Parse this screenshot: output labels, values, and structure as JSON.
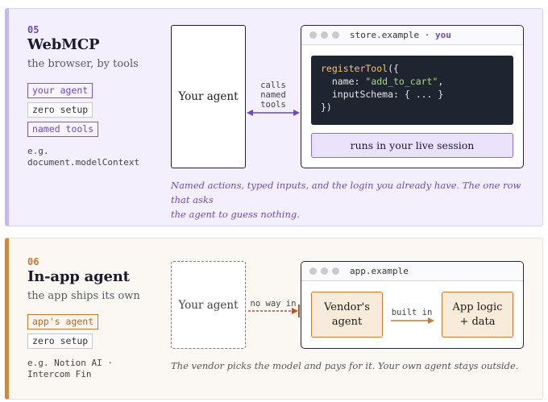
{
  "colors": {
    "purple_accent": "#6d4cb8",
    "orange_accent": "#c47a35",
    "code_bg": "#1e2430"
  },
  "sections": [
    {
      "number": "05",
      "title": "WebMCP",
      "subtitle": "the browser, by tools",
      "tags": [
        "your agent",
        "zero setup",
        "named tools"
      ],
      "example_lines": [
        "e.g.",
        "document.modelContext"
      ],
      "agent_label": "Your agent",
      "connector_label": [
        "calls",
        "named",
        "tools"
      ],
      "window": {
        "url": "store.example",
        "separator": "·",
        "url_suffix": "you",
        "code": {
          "fn": "registerTool",
          "open": "({",
          "line2_key": "  name: ",
          "line2_val": "\"add_to_cart\"",
          "line2_end": ",",
          "line3": "  inputSchema: { ... }",
          "close": "})"
        },
        "session_label": "runs in your live session"
      },
      "caption_lines": [
        "Named actions, typed inputs, and the login you already have. The one row that asks",
        "the agent to guess nothing."
      ]
    },
    {
      "number": "06",
      "title": "In-app agent",
      "subtitle": "the app ships its own",
      "tags": [
        "app's agent",
        "zero setup"
      ],
      "example_lines": [
        "e.g. Notion AI ·",
        "Intercom Fin"
      ],
      "agent_label": "Your agent",
      "connector_label": "no way in",
      "window": {
        "url": "app.example",
        "vendor_lines": [
          "Vendor's",
          "agent"
        ],
        "inner_label": "built in",
        "logic_lines": [
          "App logic",
          "+ data"
        ]
      },
      "caption": "The vendor picks the model and pays for it. Your own agent stays outside."
    }
  ]
}
